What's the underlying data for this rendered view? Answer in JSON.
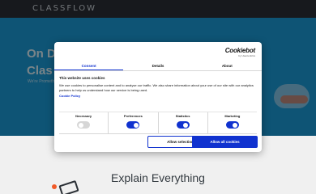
{
  "site": {
    "logo": "CLASSFLOW",
    "hero_title_line1": "On D",
    "hero_title_line2": "Clas",
    "hero_text": "We're Promethean…",
    "section_heading": "Explain Everything"
  },
  "consent": {
    "brand_name": "Cookiebot",
    "brand_sub": "by Usercentrics",
    "tabs": [
      {
        "label": "Consent",
        "active": true
      },
      {
        "label": "Details",
        "active": false
      },
      {
        "label": "About",
        "active": false
      }
    ],
    "heading": "This website uses cookies",
    "description": "We use cookies to personalise content and to analyse our traffic. We also share information about your use of our site with our analytics partners to help us understand how our service is being used.",
    "policy_link": "Cookie Policy",
    "categories": [
      {
        "label": "Necessary",
        "enabled": true,
        "locked": true
      },
      {
        "label": "Preferences",
        "enabled": true,
        "locked": false
      },
      {
        "label": "Statistics",
        "enabled": true,
        "locked": false
      },
      {
        "label": "Marketing",
        "enabled": true,
        "locked": false
      }
    ],
    "buttons": {
      "allow_selection": "Allow selection",
      "allow_all": "Allow all cookies"
    }
  },
  "colors": {
    "accent": "#1032cf",
    "hero": "#1b9ad6",
    "topbar": "#2a2f35"
  }
}
